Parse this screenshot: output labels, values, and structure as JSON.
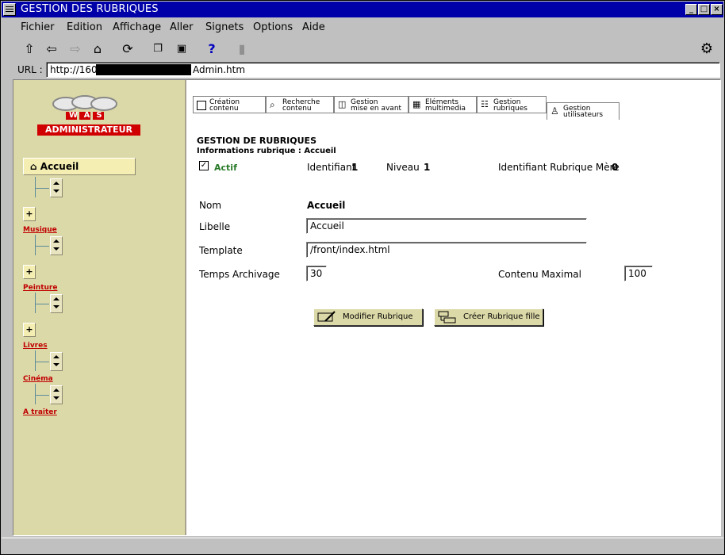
{
  "window": {
    "title": "GESTION DES RUBRIQUES"
  },
  "menu": [
    "Fichier",
    "Edition",
    "Affichage",
    "Aller",
    "Signets",
    "Options",
    "Aide"
  ],
  "toolbar": {
    "icons": [
      "forward-arrow-icon",
      "back-arrow-icon",
      "forward-disabled-icon",
      "home-icon",
      "reload-icon",
      "copy-icon",
      "paste-icon",
      "help-icon",
      "stop-icon",
      "settings-icon"
    ]
  },
  "url": {
    "label": "URL :",
    "prefix": "http://160.",
    "suffix": "Admin.htm"
  },
  "sidebar": {
    "logo_text": "WAS",
    "logo_banner": "ADMINISTRATEUR",
    "home_label": "Accueil",
    "rubriques": [
      "Musique",
      "Peinture",
      "Livres",
      "Cinéma",
      "A traiter"
    ],
    "plus_label": "+"
  },
  "tabs": [
    {
      "line1": "Création",
      "line2": "contenu"
    },
    {
      "line1": "Recherche",
      "line2": "contenu"
    },
    {
      "line1": "Gestion",
      "line2": "mise en avant"
    },
    {
      "line1": "Eléments",
      "line2": "multimedia"
    },
    {
      "line1": "Gestion",
      "line2": "rubriques"
    },
    {
      "line1": "Gestion",
      "line2": "utilisateurs"
    }
  ],
  "form": {
    "heading": "GESTION DE RUBRIQUES",
    "subheading": "Informations rubrique : Accueil",
    "actif_label": "Actif",
    "actif_checked": true,
    "checkmark": "✓",
    "identifiant_label": "Identifiant",
    "identifiant_value": "1",
    "niveau_label": "Niveau",
    "niveau_value": "1",
    "mere_label": "Identifiant Rubrique Mère",
    "mere_value": "0",
    "nom_label": "Nom",
    "nom_value": "Accueil",
    "libelle_label": "Libelle",
    "libelle_value": "Accueil",
    "template_label": "Template",
    "template_value": "/front/index.html",
    "archivage_label": "Temps Archivage",
    "archivage_value": "30",
    "contenu_label": "Contenu Maximal",
    "contenu_value": "100",
    "modifier_label": "Modifier Rubrique",
    "creer_label": "Créer Rubrique fille"
  }
}
